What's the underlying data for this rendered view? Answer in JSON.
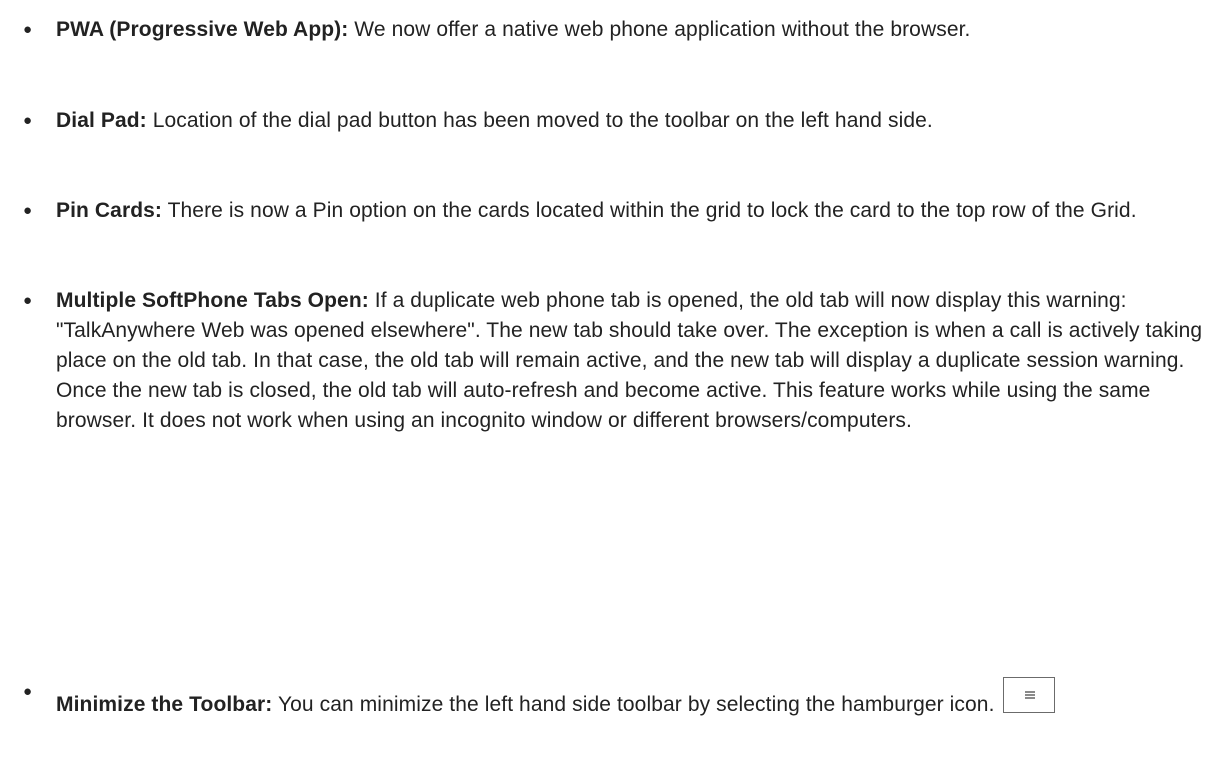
{
  "features": [
    {
      "term": "PWA (Progressive Web App):",
      "text": " We now offer a native web phone application without the browser."
    },
    {
      "term": "Dial Pad:",
      "text": "  Location of the dial pad button has been moved to the toolbar on the left hand side."
    },
    {
      "term": "Pin Cards:",
      "text": "  There is now a Pin option on the cards located within the grid to lock the card to the top row of the Grid."
    },
    {
      "term": "Multiple SoftPhone Tabs Open:",
      "text": "  If a duplicate web phone tab is opened, the old tab will now display this warning: \"TalkAnywhere Web was opened elsewhere\". The new tab should take over. The exception is when a call is actively taking place on the old tab. In that case, the old tab will remain active, and the new tab will display a duplicate session warning. Once the new tab is closed, the old tab will auto-refresh and become active. This feature works while using the same browser. It does not work when using an incognito window or different browsers/computers."
    },
    {
      "term": "Minimize the Toolbar:",
      "text": "  You can minimize the left hand side toolbar by selecting the hamburger icon."
    }
  ],
  "icons": {
    "bullet": "●",
    "hamburger": "hamburger-icon"
  }
}
